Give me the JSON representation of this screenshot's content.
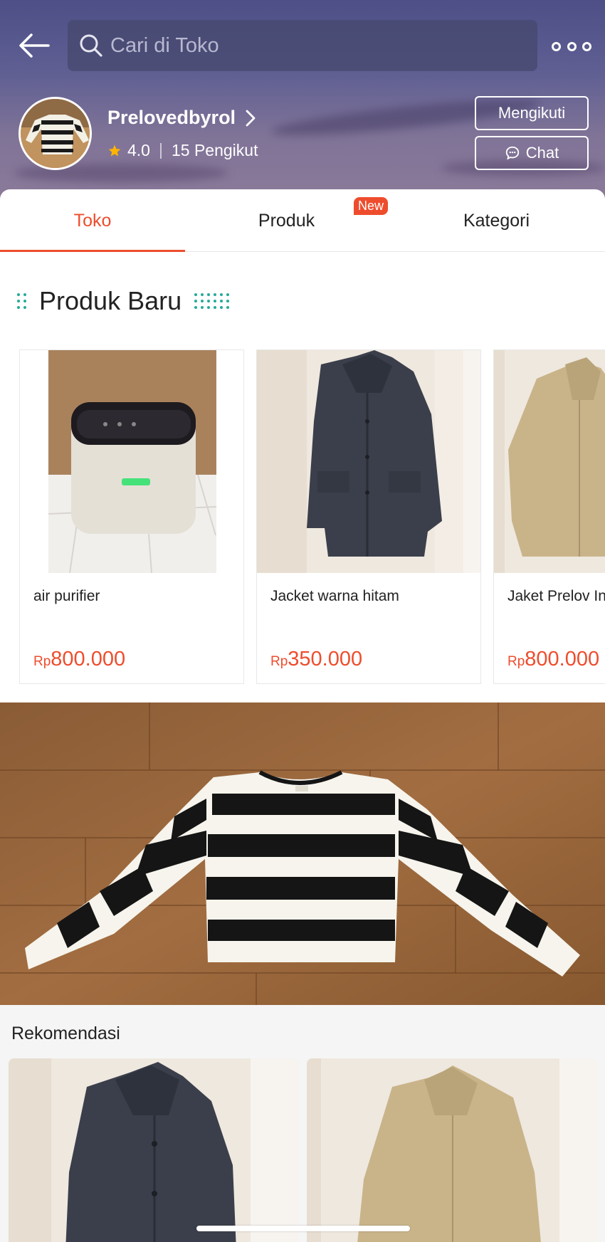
{
  "header": {
    "search_placeholder": "Cari di Toko",
    "shop_name": "Prelovedbyrol",
    "rating": "4.0",
    "followers": "15 Pengikut",
    "follow_label": "Mengikuti",
    "chat_label": "Chat"
  },
  "tabs": [
    {
      "label": "Toko",
      "active": true
    },
    {
      "label": "Produk",
      "badge": "New"
    },
    {
      "label": "Kategori"
    }
  ],
  "new_products": {
    "title": "Produk Baru",
    "items": [
      {
        "name": "air purifier",
        "currency": "Rp",
        "price": "800.000"
      },
      {
        "name": "Jacket warna hitam",
        "currency": "Rp",
        "price": "350.000"
      },
      {
        "name": "Jaket Prelov Industries EC",
        "currency": "Rp",
        "price": "800.000"
      }
    ]
  },
  "recommendations": {
    "title": "Rekomendasi"
  },
  "colors": {
    "accent": "#ee4d2d",
    "teal": "#26aa99"
  }
}
